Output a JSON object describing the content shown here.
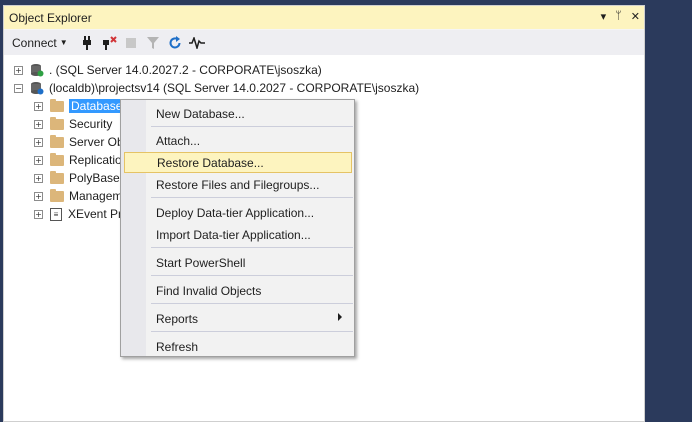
{
  "panel": {
    "title": "Object Explorer",
    "title_buttons": {
      "dropdown": "▾",
      "pin": "ᛘ",
      "close": "✕"
    }
  },
  "toolbar": {
    "connect_label": "Connect",
    "icons": [
      "connect-plug-icon",
      "disconnect-icon",
      "stop-icon",
      "filter-icon",
      "refresh-icon",
      "activity-monitor-icon"
    ]
  },
  "tree": {
    "server1": {
      "label": ". (SQL Server 14.0.2027.2 - CORPORATE\\jsoszka)",
      "expander": "+"
    },
    "server2": {
      "label": "(localdb)\\projectsv14 (SQL Server 14.0.2027 - CORPORATE\\jsoszka)",
      "expander": "−"
    },
    "children": [
      {
        "label": "Databases",
        "icon": "folder-icon",
        "selected": true
      },
      {
        "label": "Security",
        "icon": "folder-icon"
      },
      {
        "label": "Server Obj",
        "icon": "folder-icon"
      },
      {
        "label": "Replicatio",
        "icon": "folder-icon"
      },
      {
        "label": "PolyBase",
        "icon": "folder-icon"
      },
      {
        "label": "Managem",
        "icon": "folder-icon"
      },
      {
        "label": "XEvent Pr",
        "icon": "xevent-icon"
      }
    ]
  },
  "context_menu": {
    "items": [
      {
        "label": "New Database..."
      },
      {
        "label": "Attach..."
      },
      {
        "label": "Restore Database...",
        "highlighted": true
      },
      {
        "label": "Restore Files and Filegroups..."
      },
      {
        "label": "Deploy Data-tier Application..."
      },
      {
        "label": "Import Data-tier Application..."
      },
      {
        "label": "Start PowerShell"
      },
      {
        "label": "Find Invalid Objects"
      },
      {
        "label": "Reports",
        "submenu": true
      },
      {
        "label": "Refresh"
      }
    ]
  },
  "colors": {
    "background": "#2b3a5c",
    "title_bar": "#fdf4bf",
    "selection": "#3399ff",
    "menu_highlight": "#fdf4bf",
    "menu_highlight_border": "#e5c365"
  }
}
